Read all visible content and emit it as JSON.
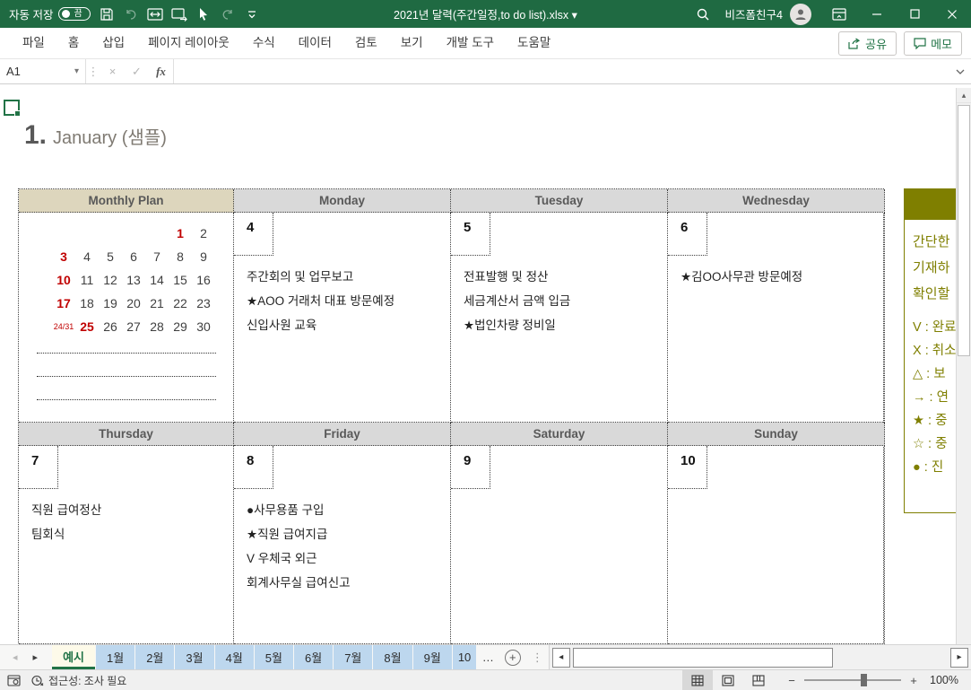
{
  "window": {
    "autosave_label": "자동 저장",
    "autosave_state": "끔",
    "title": "2021년 달력(주간일정,to do list).xlsx",
    "user_name": "비즈폼친구4"
  },
  "ribbon": {
    "tabs": [
      "파일",
      "홈",
      "삽입",
      "페이지 레이아웃",
      "수식",
      "데이터",
      "검토",
      "보기",
      "개발 도구",
      "도움말"
    ],
    "share_label": "공유",
    "memo_label": "메모"
  },
  "formula_bar": {
    "name_box_value": "A1",
    "fx_label": "fx",
    "formula_value": ""
  },
  "sheet": {
    "title_number": "1.",
    "title_text": "January (샘플)",
    "calendar": {
      "headers_row1": [
        "Monthly Plan",
        "Monday",
        "Tuesday",
        "Wednesday"
      ],
      "headers_row2": [
        "Thursday",
        "Friday",
        "Saturday",
        "Sunday"
      ],
      "mini_days": [
        {
          "t": "",
          "c": ""
        },
        {
          "t": "",
          "c": ""
        },
        {
          "t": "",
          "c": ""
        },
        {
          "t": "",
          "c": ""
        },
        {
          "t": "",
          "c": ""
        },
        {
          "t": "1",
          "c": "red"
        },
        {
          "t": "2",
          "c": ""
        },
        {
          "t": "3",
          "c": "red"
        },
        {
          "t": "4",
          "c": ""
        },
        {
          "t": "5",
          "c": ""
        },
        {
          "t": "6",
          "c": ""
        },
        {
          "t": "7",
          "c": ""
        },
        {
          "t": "8",
          "c": ""
        },
        {
          "t": "9",
          "c": ""
        },
        {
          "t": "10",
          "c": "red"
        },
        {
          "t": "11",
          "c": ""
        },
        {
          "t": "12",
          "c": ""
        },
        {
          "t": "13",
          "c": ""
        },
        {
          "t": "14",
          "c": ""
        },
        {
          "t": "15",
          "c": ""
        },
        {
          "t": "16",
          "c": ""
        },
        {
          "t": "17",
          "c": "red"
        },
        {
          "t": "18",
          "c": ""
        },
        {
          "t": "19",
          "c": ""
        },
        {
          "t": "20",
          "c": ""
        },
        {
          "t": "21",
          "c": ""
        },
        {
          "t": "22",
          "c": ""
        },
        {
          "t": "23",
          "c": ""
        },
        {
          "t": "24/31",
          "c": "tiny"
        },
        {
          "t": "25",
          "c": "red"
        },
        {
          "t": "26",
          "c": ""
        },
        {
          "t": "27",
          "c": ""
        },
        {
          "t": "28",
          "c": ""
        },
        {
          "t": "29",
          "c": ""
        },
        {
          "t": "30",
          "c": ""
        }
      ],
      "cells": {
        "monday": {
          "day": "4",
          "tasks": [
            "주간회의 및 업무보고",
            "★AOO 거래처 대표 방문예정",
            "신입사원 교육"
          ]
        },
        "tuesday": {
          "day": "5",
          "tasks": [
            "전표발행 및 정산",
            "세금계산서 금액 입금",
            "★법인차량 정비일"
          ]
        },
        "wednesday": {
          "day": "6",
          "tasks": [
            "★김OO사무관 방문예정"
          ]
        },
        "thursday": {
          "day": "7",
          "tasks": [
            "직원 급여정산",
            "팀회식"
          ]
        },
        "friday": {
          "day": "8",
          "tasks": [
            "●사무용품 구입",
            "★직원 급여지급",
            "V 우체국 외근",
            "회계사무실 급여신고"
          ]
        },
        "saturday": {
          "day": "9",
          "tasks": []
        },
        "sunday": {
          "day": "10",
          "tasks": []
        }
      }
    },
    "legend": {
      "intro_lines": [
        "간단한",
        "기재하",
        "확인할"
      ],
      "items": [
        "V : 완료",
        "X : 취소",
        "△ : 보",
        "→ : 연",
        "★ : 중",
        "☆ : 중",
        "● : 진"
      ]
    }
  },
  "sheet_tabs": {
    "tabs": [
      {
        "label": "예시",
        "cls": "active"
      },
      {
        "label": "1월",
        "cls": "month"
      },
      {
        "label": "2월",
        "cls": "month"
      },
      {
        "label": "3월",
        "cls": "month"
      },
      {
        "label": "4월",
        "cls": "month"
      },
      {
        "label": "5월",
        "cls": "month"
      },
      {
        "label": "6월",
        "cls": "month"
      },
      {
        "label": "7월",
        "cls": "month"
      },
      {
        "label": "8월",
        "cls": "month"
      },
      {
        "label": "9월",
        "cls": "month"
      },
      {
        "label": "10",
        "cls": "month partial"
      }
    ],
    "overflow_label": "…"
  },
  "status_bar": {
    "accessibility_text": "접근성: 조사 필요",
    "zoom_level": "100%"
  },
  "colors": {
    "titlebar_green": "#1f6a42",
    "accent_green": "#217346",
    "holiday_red": "#c00000",
    "legend_olive": "#7f7f00",
    "plan_header_beige": "#ddd6bd",
    "day_header_gray": "#d9d9d9",
    "month_tab_blue": "#bdd7ee"
  },
  "glyphs": {
    "dropdown": "▾",
    "nav_left": "◂",
    "nav_right": "▸",
    "up_arrow": "▴",
    "ellipsis": "…",
    "vdots": "⋮",
    "check": "✓",
    "cancel": "×",
    "minus": "−",
    "plus": "+"
  }
}
